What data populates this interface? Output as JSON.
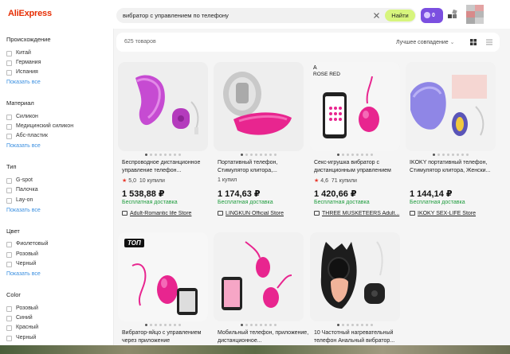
{
  "header": {
    "logo": "AliExpress",
    "search_query": "вибратор с управлением по телефону",
    "search_button": "Найти",
    "cart_count": "0"
  },
  "sidebar": {
    "groups": [
      {
        "title": "Происхождение",
        "options": [
          "Китай",
          "Германия",
          "Испания"
        ],
        "show_all": "Показать все"
      },
      {
        "title": "Материал",
        "options": [
          "Силикон",
          "Медицинский силикон",
          "Абс-пластик"
        ],
        "show_all": "Показать все"
      },
      {
        "title": "Тип",
        "options": [
          "G-spot",
          "Палочка",
          "Lay-on"
        ],
        "show_all": "Показать все"
      },
      {
        "title": "Цвет",
        "options": [
          "Фиолетовый",
          "Розовый",
          "Черный"
        ],
        "show_all": "Показать все"
      },
      {
        "title": "Color",
        "options": [
          "Розовый",
          "Синий",
          "Красный",
          "Черный"
        ]
      }
    ]
  },
  "results": {
    "count": "625 товаров",
    "sort": "Лучшее совпадение"
  },
  "products": [
    {
      "title": "Беспроводное дистанционное управление телефон...",
      "rating": "5,0",
      "sold": "10 купили",
      "price": "1 538,88 ₽",
      "shipping": "Бесплатная доставка",
      "store": "Adult-Romantic life Store"
    },
    {
      "title": "Портативный телефон, Стимулятор клитора,...",
      "rating": "",
      "sold": "1 купил",
      "price": "1 174,63 ₽",
      "shipping": "Бесплатная доставка",
      "store": "LINGKUN Official Store"
    },
    {
      "title": "Секс-игрушка вибратор с дистанционным управлением",
      "rating": "4,6",
      "sold": "71 купили",
      "price": "1 420,66 ₽",
      "shipping": "Бесплатная доставка",
      "store": "THREE MUSKETEERS Adult..."
    },
    {
      "title": "IKOKY портативный телефон, Стимулятор клитора, Женски...",
      "rating": "",
      "sold": "",
      "price": "1 144,14 ₽",
      "shipping": "Бесплатная доставка",
      "store": "IKOKY SEX-LIFE Store"
    },
    {
      "title": "Вибратор-яйцо с управлением через приложение",
      "badge": "ТОП"
    },
    {
      "title": "Мобильный телефон, приложение, дистанционное..."
    },
    {
      "title": "10 Частотный нагревательный телефон Анальный вибратор..."
    }
  ],
  "image_labels": {
    "rose_red_a": "A",
    "rose_red": "ROSE RED"
  },
  "colors": {
    "brand": "#e62e04",
    "search_button": "#d7f57d",
    "cart": "#7b4fe0",
    "shipping": "#1e9c3d",
    "link": "#3a8fe0",
    "star": "#e83a2d"
  }
}
